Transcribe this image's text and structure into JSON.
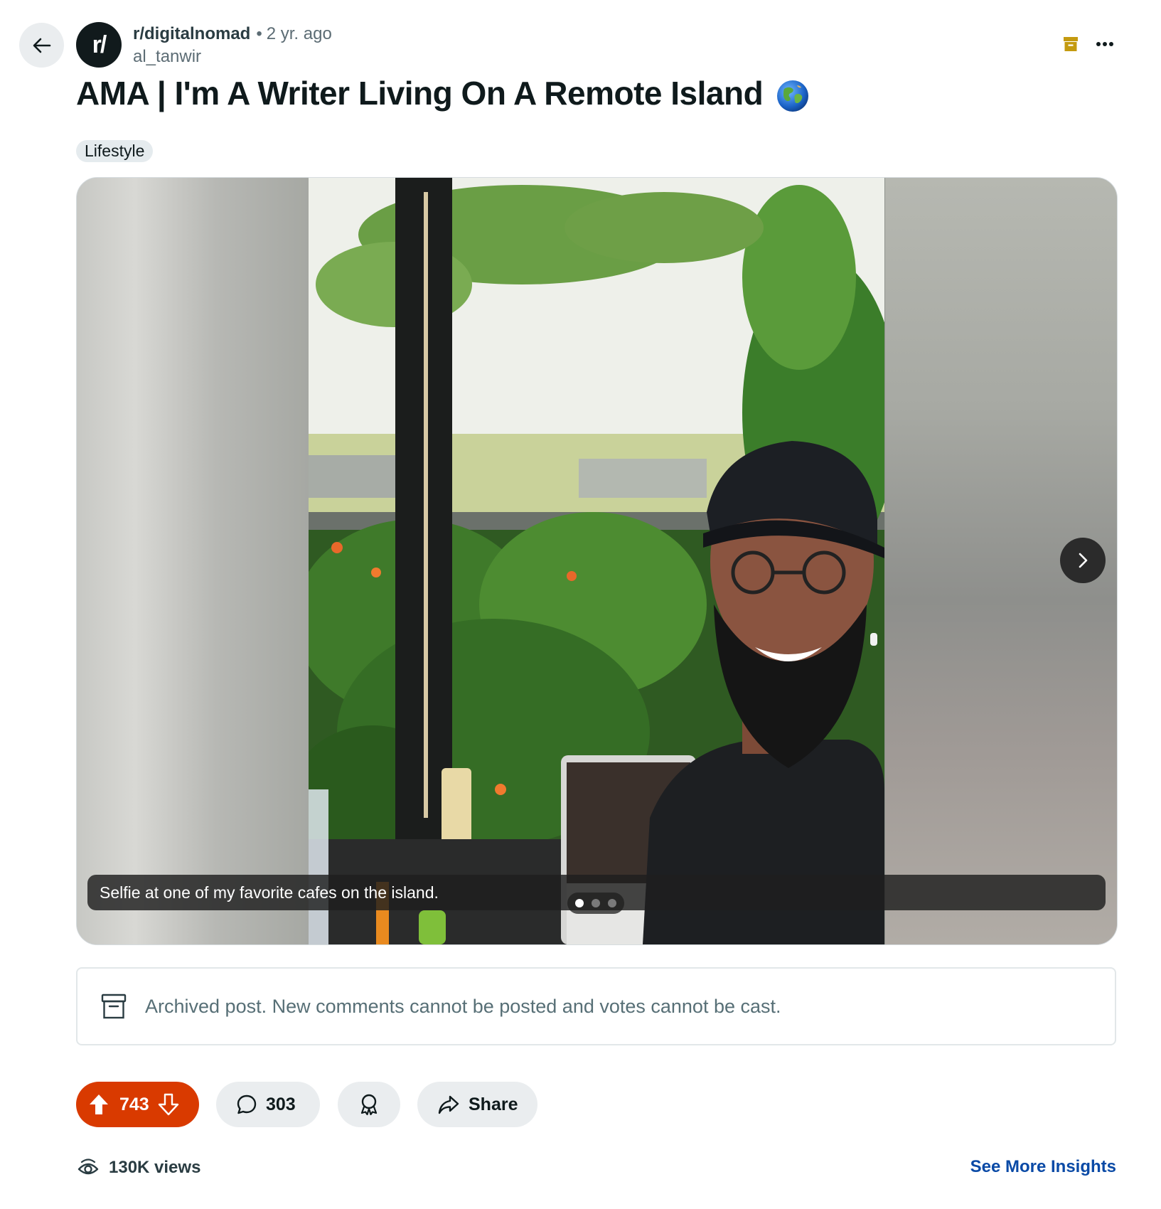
{
  "post": {
    "subreddit": "r/digitalnomad",
    "age": "2 yr. ago",
    "author": "al_tanwir",
    "title": "AMA | I'm A Writer Living On A Remote Island",
    "flair": "Lifestyle",
    "avatar_text": "r/"
  },
  "gallery": {
    "caption": "Selfie at one of my favorite cafes on the island.",
    "slide_count": 3,
    "active_slide": 1
  },
  "archived_notice": "Archived post. New comments cannot be posted and votes cannot be cast.",
  "actions": {
    "votes": "743",
    "comments": "303",
    "share_label": "Share"
  },
  "stats": {
    "views": "130K views",
    "insights_link": "See More Insights"
  },
  "colors": {
    "vote_bg": "#d93a00",
    "archive_accent": "#c49a0f",
    "link": "#0a4aa6"
  },
  "icons": [
    "back-arrow-icon",
    "archive-icon",
    "more-icon",
    "globe-icon",
    "chevron-right-icon",
    "upvote-icon",
    "downvote-icon",
    "comment-icon",
    "award-icon",
    "share-icon",
    "views-icon"
  ]
}
